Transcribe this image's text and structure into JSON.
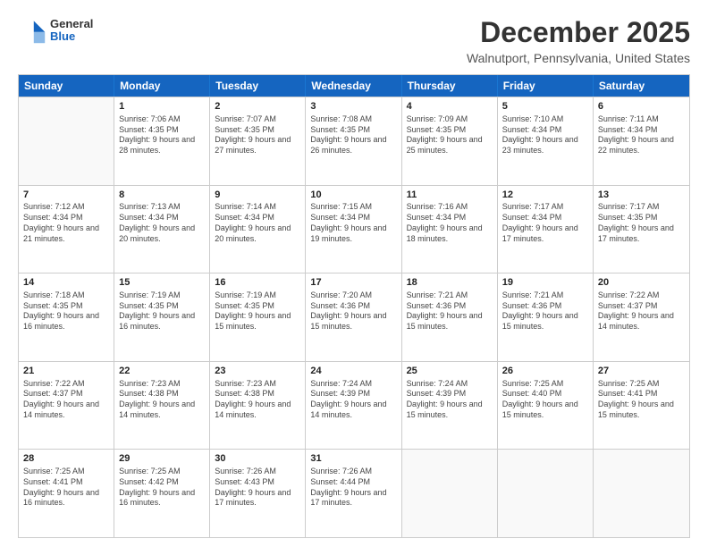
{
  "header": {
    "logo": {
      "general": "General",
      "blue": "Blue"
    },
    "title": "December 2025",
    "location": "Walnutport, Pennsylvania, United States"
  },
  "calendar": {
    "days_of_week": [
      "Sunday",
      "Monday",
      "Tuesday",
      "Wednesday",
      "Thursday",
      "Friday",
      "Saturday"
    ],
    "weeks": [
      [
        {
          "day": null,
          "sunrise": null,
          "sunset": null,
          "daylight": null
        },
        {
          "day": "1",
          "sunrise": "Sunrise: 7:06 AM",
          "sunset": "Sunset: 4:35 PM",
          "daylight": "Daylight: 9 hours and 28 minutes."
        },
        {
          "day": "2",
          "sunrise": "Sunrise: 7:07 AM",
          "sunset": "Sunset: 4:35 PM",
          "daylight": "Daylight: 9 hours and 27 minutes."
        },
        {
          "day": "3",
          "sunrise": "Sunrise: 7:08 AM",
          "sunset": "Sunset: 4:35 PM",
          "daylight": "Daylight: 9 hours and 26 minutes."
        },
        {
          "day": "4",
          "sunrise": "Sunrise: 7:09 AM",
          "sunset": "Sunset: 4:35 PM",
          "daylight": "Daylight: 9 hours and 25 minutes."
        },
        {
          "day": "5",
          "sunrise": "Sunrise: 7:10 AM",
          "sunset": "Sunset: 4:34 PM",
          "daylight": "Daylight: 9 hours and 23 minutes."
        },
        {
          "day": "6",
          "sunrise": "Sunrise: 7:11 AM",
          "sunset": "Sunset: 4:34 PM",
          "daylight": "Daylight: 9 hours and 22 minutes."
        }
      ],
      [
        {
          "day": "7",
          "sunrise": "Sunrise: 7:12 AM",
          "sunset": "Sunset: 4:34 PM",
          "daylight": "Daylight: 9 hours and 21 minutes."
        },
        {
          "day": "8",
          "sunrise": "Sunrise: 7:13 AM",
          "sunset": "Sunset: 4:34 PM",
          "daylight": "Daylight: 9 hours and 20 minutes."
        },
        {
          "day": "9",
          "sunrise": "Sunrise: 7:14 AM",
          "sunset": "Sunset: 4:34 PM",
          "daylight": "Daylight: 9 hours and 20 minutes."
        },
        {
          "day": "10",
          "sunrise": "Sunrise: 7:15 AM",
          "sunset": "Sunset: 4:34 PM",
          "daylight": "Daylight: 9 hours and 19 minutes."
        },
        {
          "day": "11",
          "sunrise": "Sunrise: 7:16 AM",
          "sunset": "Sunset: 4:34 PM",
          "daylight": "Daylight: 9 hours and 18 minutes."
        },
        {
          "day": "12",
          "sunrise": "Sunrise: 7:17 AM",
          "sunset": "Sunset: 4:34 PM",
          "daylight": "Daylight: 9 hours and 17 minutes."
        },
        {
          "day": "13",
          "sunrise": "Sunrise: 7:17 AM",
          "sunset": "Sunset: 4:35 PM",
          "daylight": "Daylight: 9 hours and 17 minutes."
        }
      ],
      [
        {
          "day": "14",
          "sunrise": "Sunrise: 7:18 AM",
          "sunset": "Sunset: 4:35 PM",
          "daylight": "Daylight: 9 hours and 16 minutes."
        },
        {
          "day": "15",
          "sunrise": "Sunrise: 7:19 AM",
          "sunset": "Sunset: 4:35 PM",
          "daylight": "Daylight: 9 hours and 16 minutes."
        },
        {
          "day": "16",
          "sunrise": "Sunrise: 7:19 AM",
          "sunset": "Sunset: 4:35 PM",
          "daylight": "Daylight: 9 hours and 15 minutes."
        },
        {
          "day": "17",
          "sunrise": "Sunrise: 7:20 AM",
          "sunset": "Sunset: 4:36 PM",
          "daylight": "Daylight: 9 hours and 15 minutes."
        },
        {
          "day": "18",
          "sunrise": "Sunrise: 7:21 AM",
          "sunset": "Sunset: 4:36 PM",
          "daylight": "Daylight: 9 hours and 15 minutes."
        },
        {
          "day": "19",
          "sunrise": "Sunrise: 7:21 AM",
          "sunset": "Sunset: 4:36 PM",
          "daylight": "Daylight: 9 hours and 15 minutes."
        },
        {
          "day": "20",
          "sunrise": "Sunrise: 7:22 AM",
          "sunset": "Sunset: 4:37 PM",
          "daylight": "Daylight: 9 hours and 14 minutes."
        }
      ],
      [
        {
          "day": "21",
          "sunrise": "Sunrise: 7:22 AM",
          "sunset": "Sunset: 4:37 PM",
          "daylight": "Daylight: 9 hours and 14 minutes."
        },
        {
          "day": "22",
          "sunrise": "Sunrise: 7:23 AM",
          "sunset": "Sunset: 4:38 PM",
          "daylight": "Daylight: 9 hours and 14 minutes."
        },
        {
          "day": "23",
          "sunrise": "Sunrise: 7:23 AM",
          "sunset": "Sunset: 4:38 PM",
          "daylight": "Daylight: 9 hours and 14 minutes."
        },
        {
          "day": "24",
          "sunrise": "Sunrise: 7:24 AM",
          "sunset": "Sunset: 4:39 PM",
          "daylight": "Daylight: 9 hours and 14 minutes."
        },
        {
          "day": "25",
          "sunrise": "Sunrise: 7:24 AM",
          "sunset": "Sunset: 4:39 PM",
          "daylight": "Daylight: 9 hours and 15 minutes."
        },
        {
          "day": "26",
          "sunrise": "Sunrise: 7:25 AM",
          "sunset": "Sunset: 4:40 PM",
          "daylight": "Daylight: 9 hours and 15 minutes."
        },
        {
          "day": "27",
          "sunrise": "Sunrise: 7:25 AM",
          "sunset": "Sunset: 4:41 PM",
          "daylight": "Daylight: 9 hours and 15 minutes."
        }
      ],
      [
        {
          "day": "28",
          "sunrise": "Sunrise: 7:25 AM",
          "sunset": "Sunset: 4:41 PM",
          "daylight": "Daylight: 9 hours and 16 minutes."
        },
        {
          "day": "29",
          "sunrise": "Sunrise: 7:25 AM",
          "sunset": "Sunset: 4:42 PM",
          "daylight": "Daylight: 9 hours and 16 minutes."
        },
        {
          "day": "30",
          "sunrise": "Sunrise: 7:26 AM",
          "sunset": "Sunset: 4:43 PM",
          "daylight": "Daylight: 9 hours and 17 minutes."
        },
        {
          "day": "31",
          "sunrise": "Sunrise: 7:26 AM",
          "sunset": "Sunset: 4:44 PM",
          "daylight": "Daylight: 9 hours and 17 minutes."
        },
        {
          "day": null,
          "sunrise": null,
          "sunset": null,
          "daylight": null
        },
        {
          "day": null,
          "sunrise": null,
          "sunset": null,
          "daylight": null
        },
        {
          "day": null,
          "sunrise": null,
          "sunset": null,
          "daylight": null
        }
      ]
    ]
  }
}
